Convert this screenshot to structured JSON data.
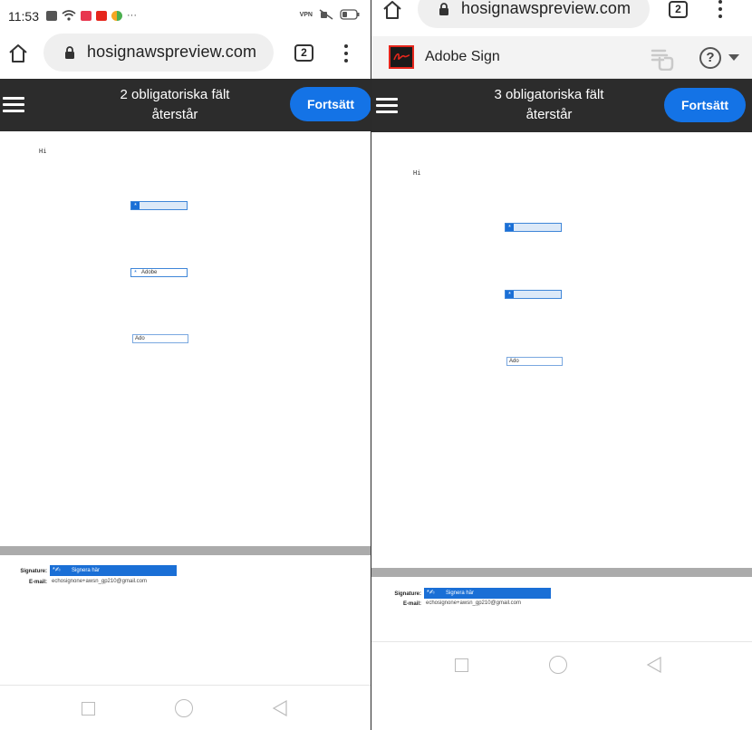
{
  "left": {
    "status": {
      "time": "11:53",
      "more": "···",
      "vpn": "VPN"
    },
    "browser": {
      "url": "hosignawspreview.com",
      "tab_count": "2"
    },
    "action_bar": {
      "required_line1": "2 obligatoriska fält",
      "required_line2": "återstår",
      "continue_label": "Fortsätt"
    },
    "document": {
      "heading": "Hi",
      "field1_value": "",
      "field2_value": "Adobe",
      "field3_value": "Ado"
    },
    "signature": {
      "signature_label": "Signature:",
      "sign_button": "Signera här",
      "email_label": "E-mail:",
      "email_value": "echosignone+awsn_gp210@gmail.com"
    }
  },
  "right": {
    "browser": {
      "url": "hosignawspreview.com",
      "tab_count": "2"
    },
    "adobe_header": {
      "title": "Adobe Sign",
      "help": "?"
    },
    "action_bar": {
      "required_line1": "3 obligatoriska fält",
      "required_line2": "återstår",
      "continue_label": "Fortsätt"
    },
    "document": {
      "heading": "Hi",
      "field1_value": "",
      "field2_value": "",
      "field3_value": "Ado"
    },
    "signature": {
      "signature_label": "Signature:",
      "sign_button": "Signera här",
      "email_label": "E-mail:",
      "email_value": "echosignone+awsn_gp210@gmail.com"
    }
  },
  "colors": {
    "accent": "#1473e6",
    "action_bar": "#2c2c2c",
    "field_fill": "#dce9f8",
    "adobe_red": "#e5261c"
  },
  "icons": [
    "home-icon",
    "lock-icon",
    "kebab-icon",
    "menu-icon",
    "adobe-logo-icon",
    "hand-icon",
    "help-icon",
    "chevron-down-icon",
    "asterisk-icon",
    "wifi-icon",
    "battery-icon"
  ]
}
